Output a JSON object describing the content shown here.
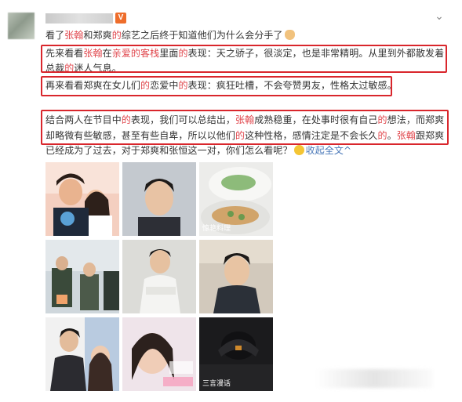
{
  "header": {
    "username": "用户",
    "verified_badge": "V",
    "chevron": "⌄"
  },
  "post": {
    "line1_pre": "看了",
    "line1_name1": "张翰",
    "line1_mid": "和郑爽",
    "line1_de": "的",
    "line1_post": "综艺之后终于知道他们为什么会分手了",
    "line2_pre": "先来看看",
    "line2_name": "张翰",
    "line2_mid": "在",
    "line2_show": "亲爱的客栈",
    "line2_post1": "里面",
    "line2_de": "的",
    "line2_post2": "表现：天之骄子，很淡定，也是非常精明。从里到外都散发着",
    "line3_pre": "总裁",
    "line3_de": "的",
    "line3_post": "迷人气息。",
    "line4_pre": "再来看看郑爽在女儿们",
    "line4_de1": "的",
    "line4_mid": "恋爱中",
    "line4_de2": "的",
    "line4_post": "表现：疯狂吐槽，不会夸赞男友，性格太过敏感。",
    "line5_pre": "结合两人在节目中",
    "line5_de1": "的",
    "line5_mid": "表现，我们可以总结出，",
    "line5_name": "张翰",
    "line5_post1": "成熟稳重，在处事时很有自己",
    "line5_de2": "的",
    "line5_post2": "想法，而郑爽",
    "line6_pre": "却略微有些敏感，甚至有些自卑，所以以他们",
    "line6_de1": "的",
    "line6_mid": "这种性格，感情注定是不会长久",
    "line6_de2": "的",
    "line6_end": "。",
    "line6_name": "张翰",
    "line6_post": "跟郑爽",
    "line7_text": "已经成为了过去，对于郑爽和张恒这一对，你们怎么看呢？",
    "line7_expand": "收起全文",
    "line7_caret": "^"
  },
  "images": {
    "captions": [
      "",
      "",
      "惊艳料理",
      "",
      "",
      "",
      "",
      "",
      "三言漫话"
    ]
  },
  "colors": {
    "highlight": "#e0464c",
    "box": "#d9262c",
    "link": "#4a78b8"
  }
}
